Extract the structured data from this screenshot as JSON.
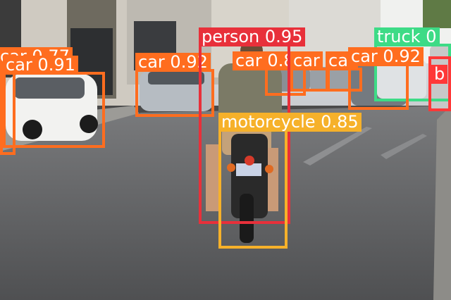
{
  "image": {
    "description_free": true
  },
  "detections": [
    {
      "id": "car-a",
      "label": "car",
      "score": "0.77",
      "color": "#ff6d1f"
    },
    {
      "id": "car-b",
      "label": "car",
      "score": "0.91",
      "color": "#ff6d1f"
    },
    {
      "id": "car-c",
      "label": "car",
      "score": "0.92",
      "color": "#ff6d1f"
    },
    {
      "id": "car-d",
      "label": "car",
      "score": "0.82",
      "color": "#ff6d1f"
    },
    {
      "id": "car-e",
      "label": "car",
      "score": "",
      "color": "#ff6d1f"
    },
    {
      "id": "car-f",
      "label": "car",
      "score": "",
      "color": "#ff6d1f"
    },
    {
      "id": "car-g",
      "label": "car",
      "score": "0.92",
      "color": "#ff6d1f"
    },
    {
      "id": "truck-a",
      "label": "truck",
      "score": "0",
      "color": "#3ddb86"
    },
    {
      "id": "b-a",
      "label": "b",
      "score": "",
      "color": "#ff3838"
    },
    {
      "id": "person-a",
      "label": "person",
      "score": "0.95",
      "color": "#e8303a"
    },
    {
      "id": "moto-a",
      "label": "motorcycle",
      "score": "0.85",
      "color": "#f6b12a"
    }
  ]
}
